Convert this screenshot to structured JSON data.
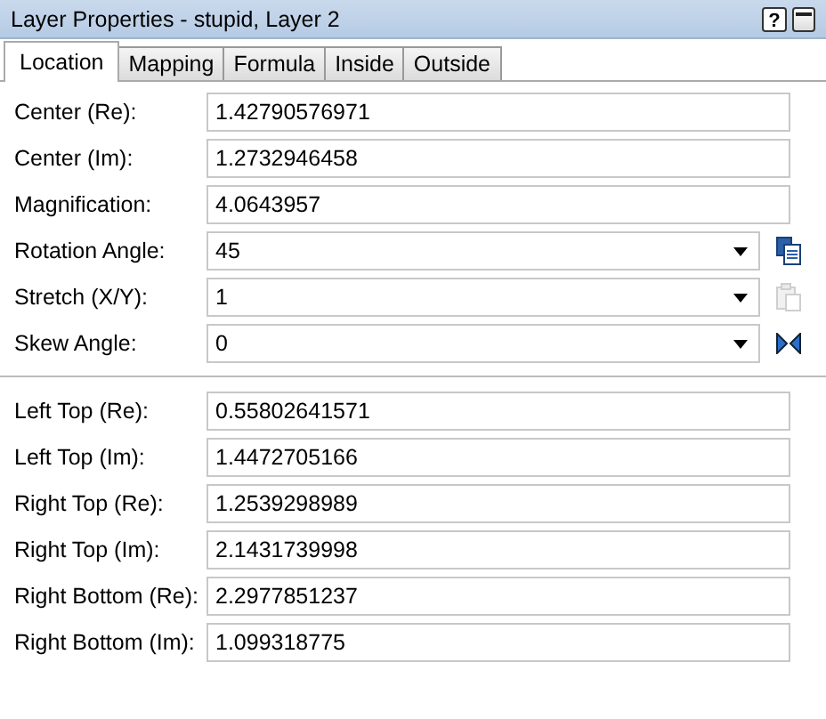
{
  "window": {
    "title": "Layer Properties - stupid, Layer 2",
    "help": "?"
  },
  "tabs": [
    {
      "label": "Location",
      "selected": true
    },
    {
      "label": "Mapping",
      "selected": false
    },
    {
      "label": "Formula",
      "selected": false
    },
    {
      "label": "Inside",
      "selected": false
    },
    {
      "label": "Outside",
      "selected": false
    }
  ],
  "sections": [
    {
      "rows": [
        {
          "label": "Center (Re):",
          "kind": "text",
          "value": "1.42790576971"
        },
        {
          "label": "Center (Im):",
          "kind": "text",
          "value": "1.2732946458"
        },
        {
          "label": "Magnification:",
          "kind": "text",
          "value": "4.0643957"
        },
        {
          "label": "Rotation Angle:",
          "kind": "combo",
          "value": "45",
          "action": {
            "kind": "copy",
            "disabled": false
          }
        },
        {
          "label": "Stretch (X/Y):",
          "kind": "combo",
          "value": "1",
          "action": {
            "kind": "paste",
            "disabled": true
          }
        },
        {
          "label": "Skew Angle:",
          "kind": "combo",
          "value": "0",
          "action": {
            "kind": "flip",
            "disabled": false
          }
        }
      ]
    },
    {
      "rows": [
        {
          "label": "Left Top (Re):",
          "kind": "text",
          "value": "0.55802641571"
        },
        {
          "label": "Left Top (Im):",
          "kind": "text",
          "value": "1.4472705166"
        },
        {
          "label": "Right Top (Re):",
          "kind": "text",
          "value": "1.2539298989"
        },
        {
          "label": "Right Top (Im):",
          "kind": "text",
          "value": "2.1431739998"
        },
        {
          "label": "Right Bottom (Re):",
          "kind": "text",
          "value": "2.2977851237"
        },
        {
          "label": "Right Bottom (Im):",
          "kind": "text",
          "value": "1.099318775"
        }
      ]
    }
  ]
}
